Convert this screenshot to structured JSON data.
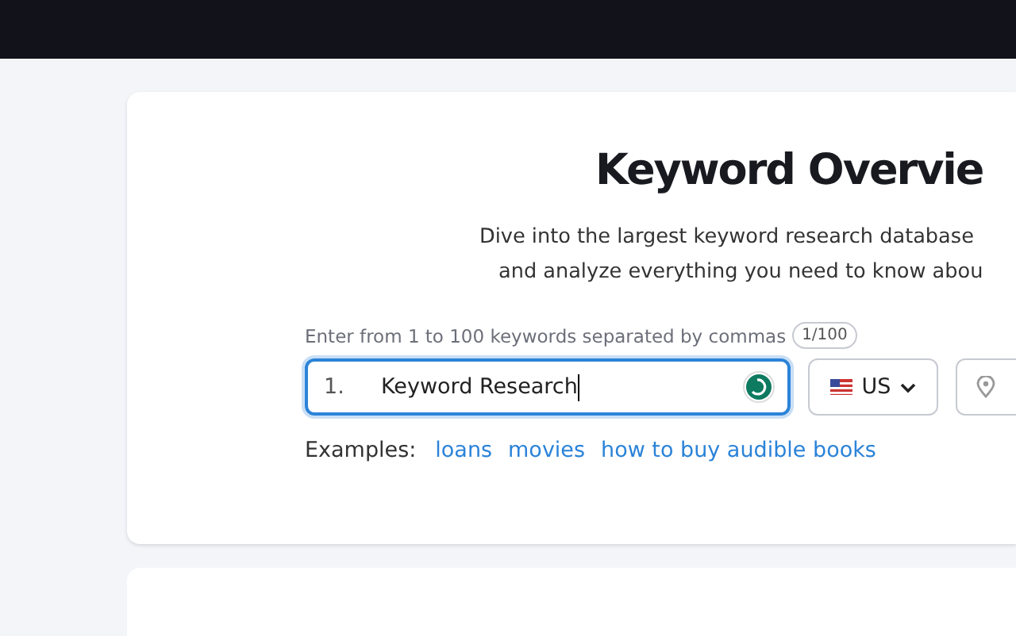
{
  "header": {
    "title": "Keyword Overvie",
    "subtitle_lines": [
      "Dive into the largest keyword research database",
      "and analyze everything you need to know abou"
    ]
  },
  "keyword_input": {
    "hint": "Enter from 1 to 100 keywords separated by commas",
    "counter": "1/100",
    "line_number": "1.",
    "value": "Keyword Research"
  },
  "database_select": {
    "value": "US"
  },
  "examples": {
    "label": "Examples:",
    "links": [
      "loans",
      "movies",
      "how to buy audible books"
    ]
  }
}
